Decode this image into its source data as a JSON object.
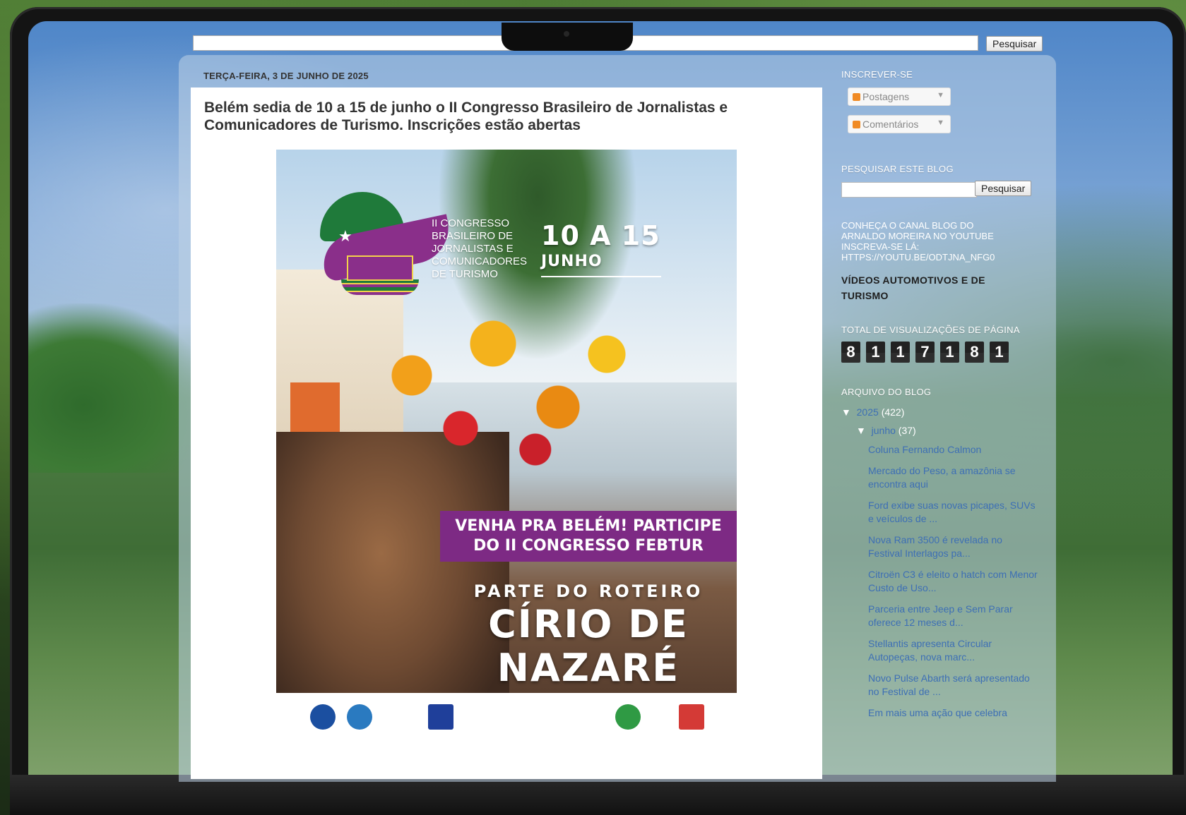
{
  "navbar": {
    "search_button": "Pesquisar"
  },
  "post": {
    "date": "TERÇA-FEIRA, 3 DE JUNHO DE 2025",
    "title": "Belém sedia de 10 a 15 de junho o II Congresso Brasileiro de Jornalistas e Comunicadores de Turismo. Inscrições estão abertas",
    "poster": {
      "congresso": "II CONGRESSO BRASILEIRO DE JORNALISTAS E COMUNICADORES DE TURISMO",
      "dates": "10 A 15",
      "month": "JUNHO",
      "banner_line1": "VENHA PRA BELÉM! PARTICIPE",
      "banner_line2": "DO II CONGRESSO FEBTUR",
      "roteiro": "PARTE DO ROTEIRO",
      "cirio_line1": "CÍRIO DE",
      "cirio_line2": "NAZARÉ"
    }
  },
  "sidebar": {
    "subscribe_title": "INSCREVER-SE",
    "subscribe_posts": "Postagens",
    "subscribe_comments": "Comentários",
    "search_title": "PESQUISAR ESTE BLOG",
    "search_button": "Pesquisar",
    "youtube_text": "CONHEÇA O CANAL BLOG DO ARNALDO MOREIRA NO YOUTUBE INSCREVA-SE LÁ: HTTPS://YOUTU.BE/ODTJNA_NFG0",
    "videos_title": "VÍDEOS AUTOMOTIVOS E DE TURISMO",
    "pageviews_title": "TOTAL DE VISUALIZAÇÕES DE PÁGINA",
    "pageviews_digits": [
      "8",
      "1",
      "1",
      "7",
      "1",
      "8",
      "1"
    ],
    "archive_title": "ARQUIVO DO BLOG",
    "archive_year": "2025",
    "archive_year_count": "(422)",
    "archive_month": "junho",
    "archive_month_count": "(37)",
    "archive_posts": [
      "Coluna Fernando Calmon",
      "Mercado do Peso, a amazônia se encontra aqui",
      "Ford exibe suas novas picapes, SUVs e veículos de ...",
      "Nova Ram 3500 é revelada no Festival Interlagos pa...",
      "Citroën C3 é eleito o hatch com Menor Custo de Uso...",
      "Parceria entre Jeep e Sem Parar oferece 12 meses d...",
      "Stellantis apresenta Circular Autopeças, nova marc...",
      "Novo Pulse Abarth será apresentado no Festival de ...",
      "Em mais uma ação que celebra"
    ]
  }
}
